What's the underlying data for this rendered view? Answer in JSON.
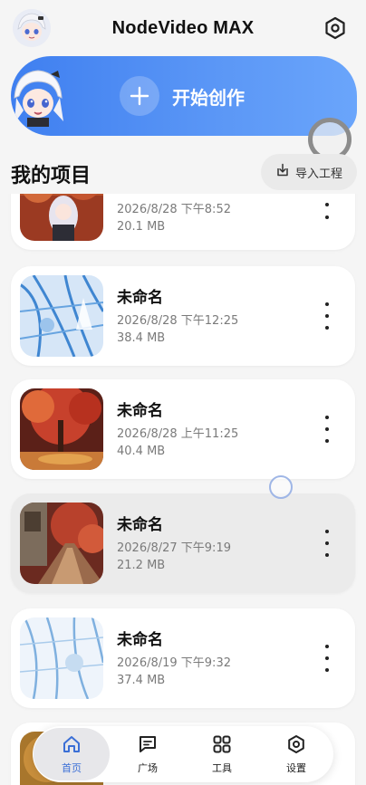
{
  "app": {
    "title": "NodeVideo MAX"
  },
  "banner": {
    "create_label": "开始创作"
  },
  "section": {
    "title": "我的项目",
    "import_label": "导入工程"
  },
  "projects": [
    {
      "name": "",
      "date": "2026/8/28 下午8:52",
      "size": "20.1 MB"
    },
    {
      "name": "未命名",
      "date": "2026/8/28 下午12:25",
      "size": "38.4 MB"
    },
    {
      "name": "未命名",
      "date": "2026/8/28 上午11:25",
      "size": "40.4 MB"
    },
    {
      "name": "未命名",
      "date": "2026/8/27 下午9:19",
      "size": "21.2 MB"
    },
    {
      "name": "未命名",
      "date": "2026/8/19 下午9:32",
      "size": "37.4 MB"
    }
  ],
  "nav": [
    {
      "label": "首页",
      "icon": "home-icon",
      "active": true
    },
    {
      "label": "广场",
      "icon": "chat-icon",
      "active": false
    },
    {
      "label": "工具",
      "icon": "grid-icon",
      "active": false
    },
    {
      "label": "设置",
      "icon": "settings-icon",
      "active": false
    }
  ],
  "colors": {
    "accent": "#3f7ff0",
    "active_nav": "#3b6fd6"
  }
}
